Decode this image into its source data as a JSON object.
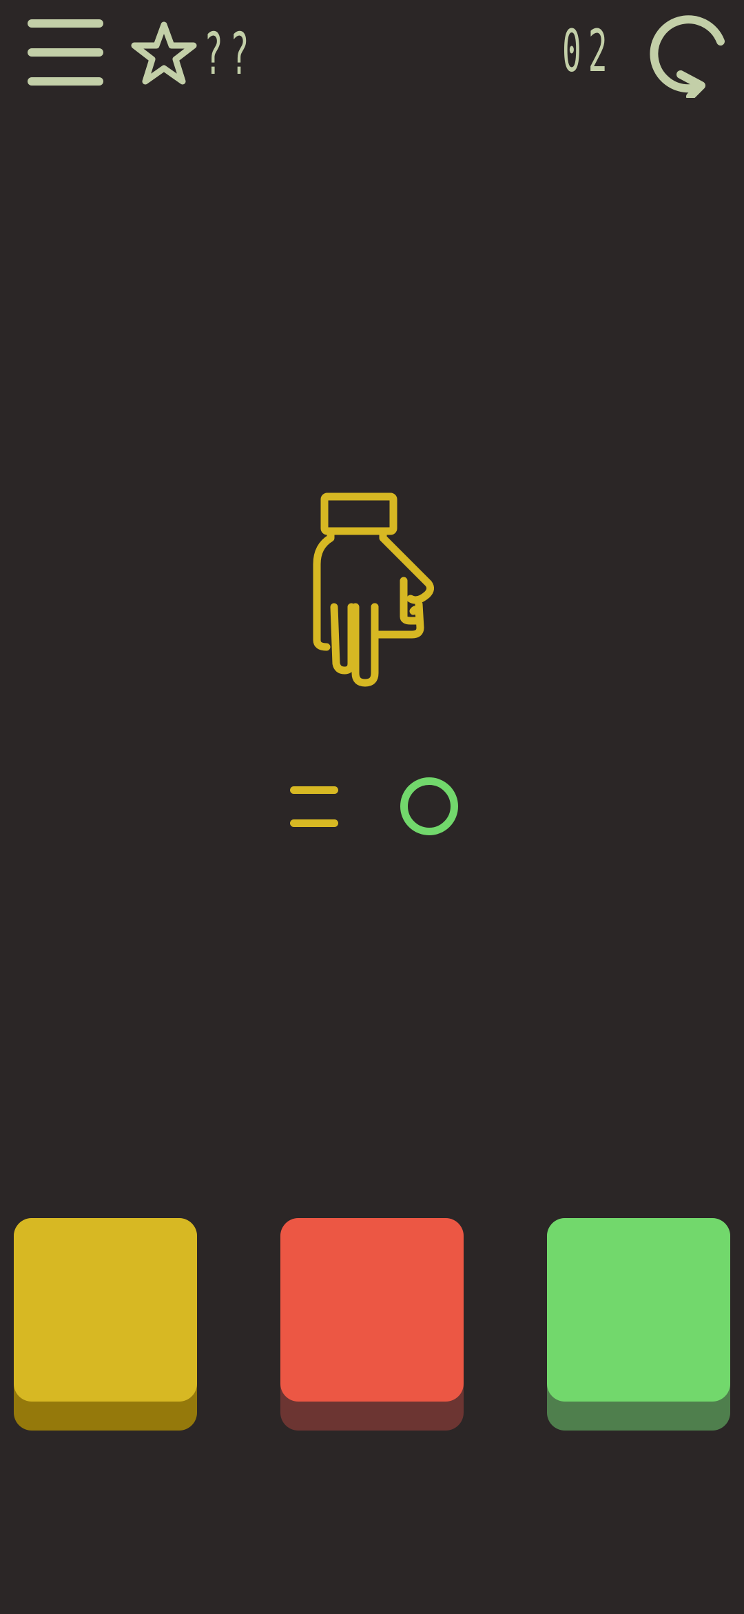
{
  "header": {
    "menu_icon": "hamburger-menu-icon",
    "star_icon": "star-outline-icon",
    "star_score": "??",
    "level_number": "02",
    "restart_icon": "restart-arrow-icon"
  },
  "puzzle": {
    "clue_icon": "pointing-down-hand-icon",
    "operator": "=",
    "answer_shape": "circle",
    "answer_color": "#72d86c"
  },
  "options": [
    {
      "name": "yellow",
      "color": "#d7b823",
      "shadow": "#95790b"
    },
    {
      "name": "red",
      "color": "#ec5744",
      "shadow": "#6c3532"
    },
    {
      "name": "green",
      "color": "#72d86c",
      "shadow": "#4f7f4d"
    }
  ],
  "palette": {
    "background": "#2b2626",
    "ui_foreground": "#c3cfa8",
    "hand_stroke": "#d7b823"
  }
}
